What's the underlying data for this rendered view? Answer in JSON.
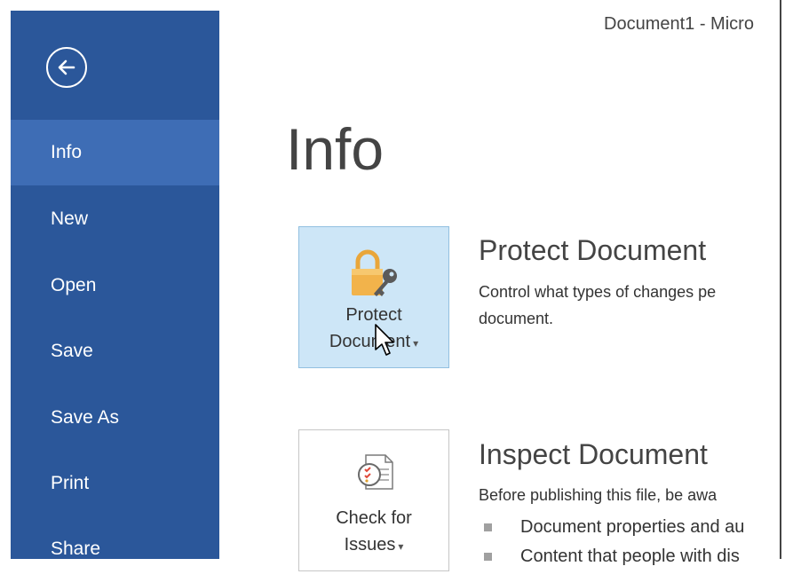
{
  "window": {
    "title": "Document1 - Micro"
  },
  "sidebar": {
    "back_label": "back",
    "items": [
      {
        "label": "Info",
        "active": true
      },
      {
        "label": "New"
      },
      {
        "label": "Open"
      },
      {
        "label": "Save"
      },
      {
        "label": "Save As"
      },
      {
        "label": "Print"
      },
      {
        "label": "Share"
      }
    ]
  },
  "main": {
    "title": "Info",
    "sections": [
      {
        "tile_line1": "Protect",
        "tile_line2": "Document",
        "heading": "Protect Document",
        "desc_line1": "Control what types of changes pe",
        "desc_line2": "document."
      },
      {
        "tile_line1": "Check for",
        "tile_line2": "Issues",
        "heading": "Inspect Document",
        "desc_line1": "Before publishing this file, be awa",
        "bullets": [
          "Document properties and au",
          "Content that people with dis"
        ]
      }
    ]
  },
  "icons": {
    "back": "back-arrow-icon",
    "protect": "lock-key-icon",
    "inspect": "check-issues-icon",
    "cursor": "mouse-pointer-icon"
  },
  "colors": {
    "sidebar": "#2b579a",
    "sidebar_active": "#3e6db5",
    "tile_hover": "#cde6f7",
    "lock": "#f2b34b"
  }
}
